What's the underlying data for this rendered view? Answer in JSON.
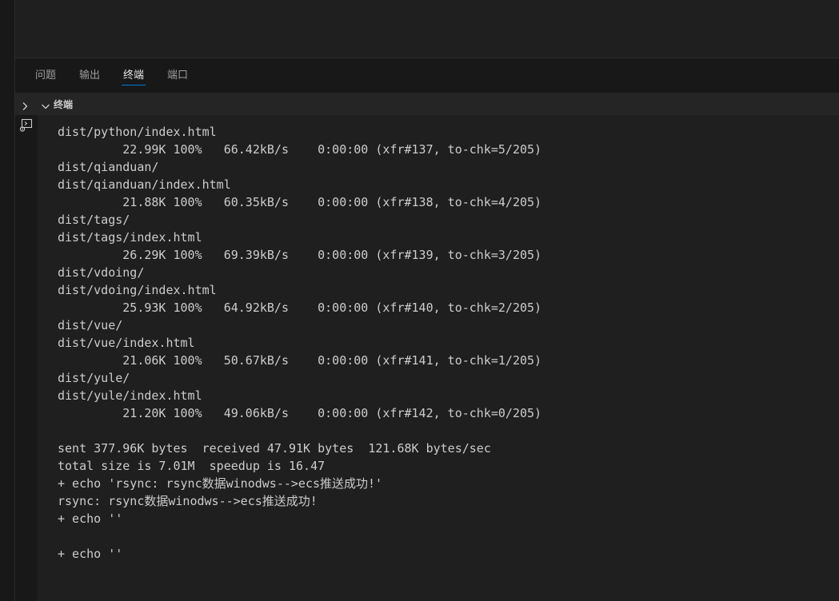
{
  "panel": {
    "tabs": [
      {
        "label": "问题",
        "active": false
      },
      {
        "label": "输出",
        "active": false
      },
      {
        "label": "终端",
        "active": true
      },
      {
        "label": "端口",
        "active": false
      }
    ],
    "section_title": "终端",
    "icons": {
      "collapse": "chevron-right-icon",
      "expand": "chevron-down-icon",
      "terminal": "terminal-icon"
    }
  },
  "terminal": {
    "lines": [
      "dist/python/index.html",
      "         22.99K 100%   66.42kB/s    0:00:00 (xfr#137, to-chk=5/205)",
      "dist/qianduan/",
      "dist/qianduan/index.html",
      "         21.88K 100%   60.35kB/s    0:00:00 (xfr#138, to-chk=4/205)",
      "dist/tags/",
      "dist/tags/index.html",
      "         26.29K 100%   69.39kB/s    0:00:00 (xfr#139, to-chk=3/205)",
      "dist/vdoing/",
      "dist/vdoing/index.html",
      "         25.93K 100%   64.92kB/s    0:00:00 (xfr#140, to-chk=2/205)",
      "dist/vue/",
      "dist/vue/index.html",
      "         21.06K 100%   50.67kB/s    0:00:00 (xfr#141, to-chk=1/205)",
      "dist/yule/",
      "dist/yule/index.html",
      "         21.20K 100%   49.06kB/s    0:00:00 (xfr#142, to-chk=0/205)",
      "",
      "sent 377.96K bytes  received 47.91K bytes  121.68K bytes/sec",
      "total size is 7.01M  speedup is 16.47",
      "+ echo 'rsync: rsync数据winodws-->ecs推送成功!'",
      "rsync: rsync数据winodws-->ecs推送成功!",
      "+ echo ''",
      "",
      "+ echo ''"
    ]
  },
  "colors": {
    "background": "#1f1f1f",
    "panel": "#181818",
    "text": "#cccccc",
    "accent": "#0078d4"
  }
}
